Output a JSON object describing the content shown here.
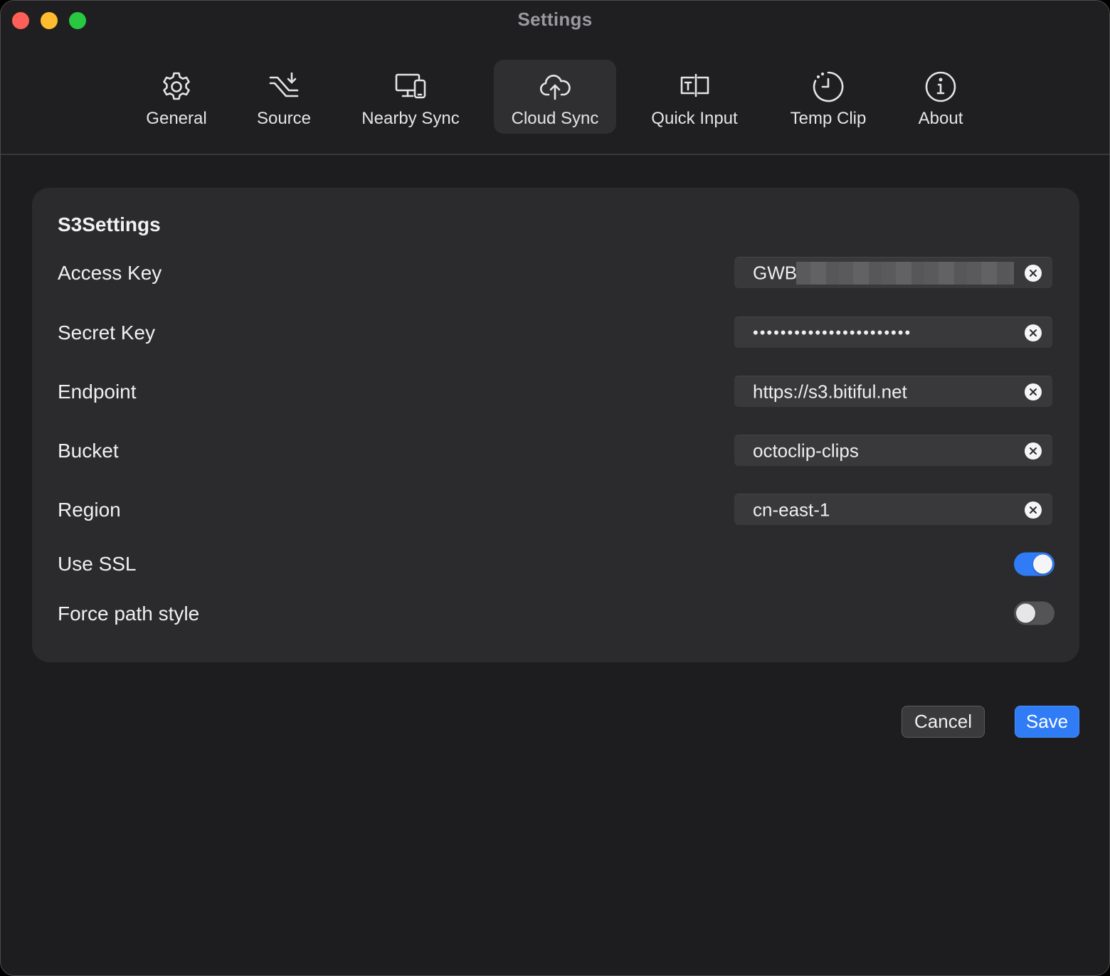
{
  "window": {
    "title": "Settings"
  },
  "tabs": [
    {
      "label": "General",
      "icon": "gear-icon"
    },
    {
      "label": "Source",
      "icon": "source-arrow-icon"
    },
    {
      "label": "Nearby Sync",
      "icon": "devices-icon"
    },
    {
      "label": "Cloud Sync",
      "icon": "cloud-upload-icon",
      "active": true
    },
    {
      "label": "Quick Input",
      "icon": "text-input-icon"
    },
    {
      "label": "Temp Clip",
      "icon": "timer-icon"
    },
    {
      "label": "About",
      "icon": "info-icon"
    }
  ],
  "panel": {
    "title": "S3Settings",
    "fields": {
      "access_key": {
        "label": "Access Key",
        "value": "GWB"
      },
      "secret_key": {
        "label": "Secret Key",
        "value": "•••••••••••••••••••••••"
      },
      "endpoint": {
        "label": "Endpoint",
        "value": "https://s3.bitiful.net"
      },
      "bucket": {
        "label": "Bucket",
        "value": "octoclip-clips"
      },
      "region": {
        "label": "Region",
        "value": "cn-east-1"
      }
    },
    "toggles": {
      "use_ssl": {
        "label": "Use SSL",
        "on": true
      },
      "force_path_style": {
        "label": "Force path style",
        "on": false
      }
    }
  },
  "buttons": {
    "cancel": "Cancel",
    "save": "Save"
  },
  "colors": {
    "accent": "#2f7cf6",
    "window_bg": "#1d1d1f",
    "panel_bg": "#2b2b2d"
  }
}
